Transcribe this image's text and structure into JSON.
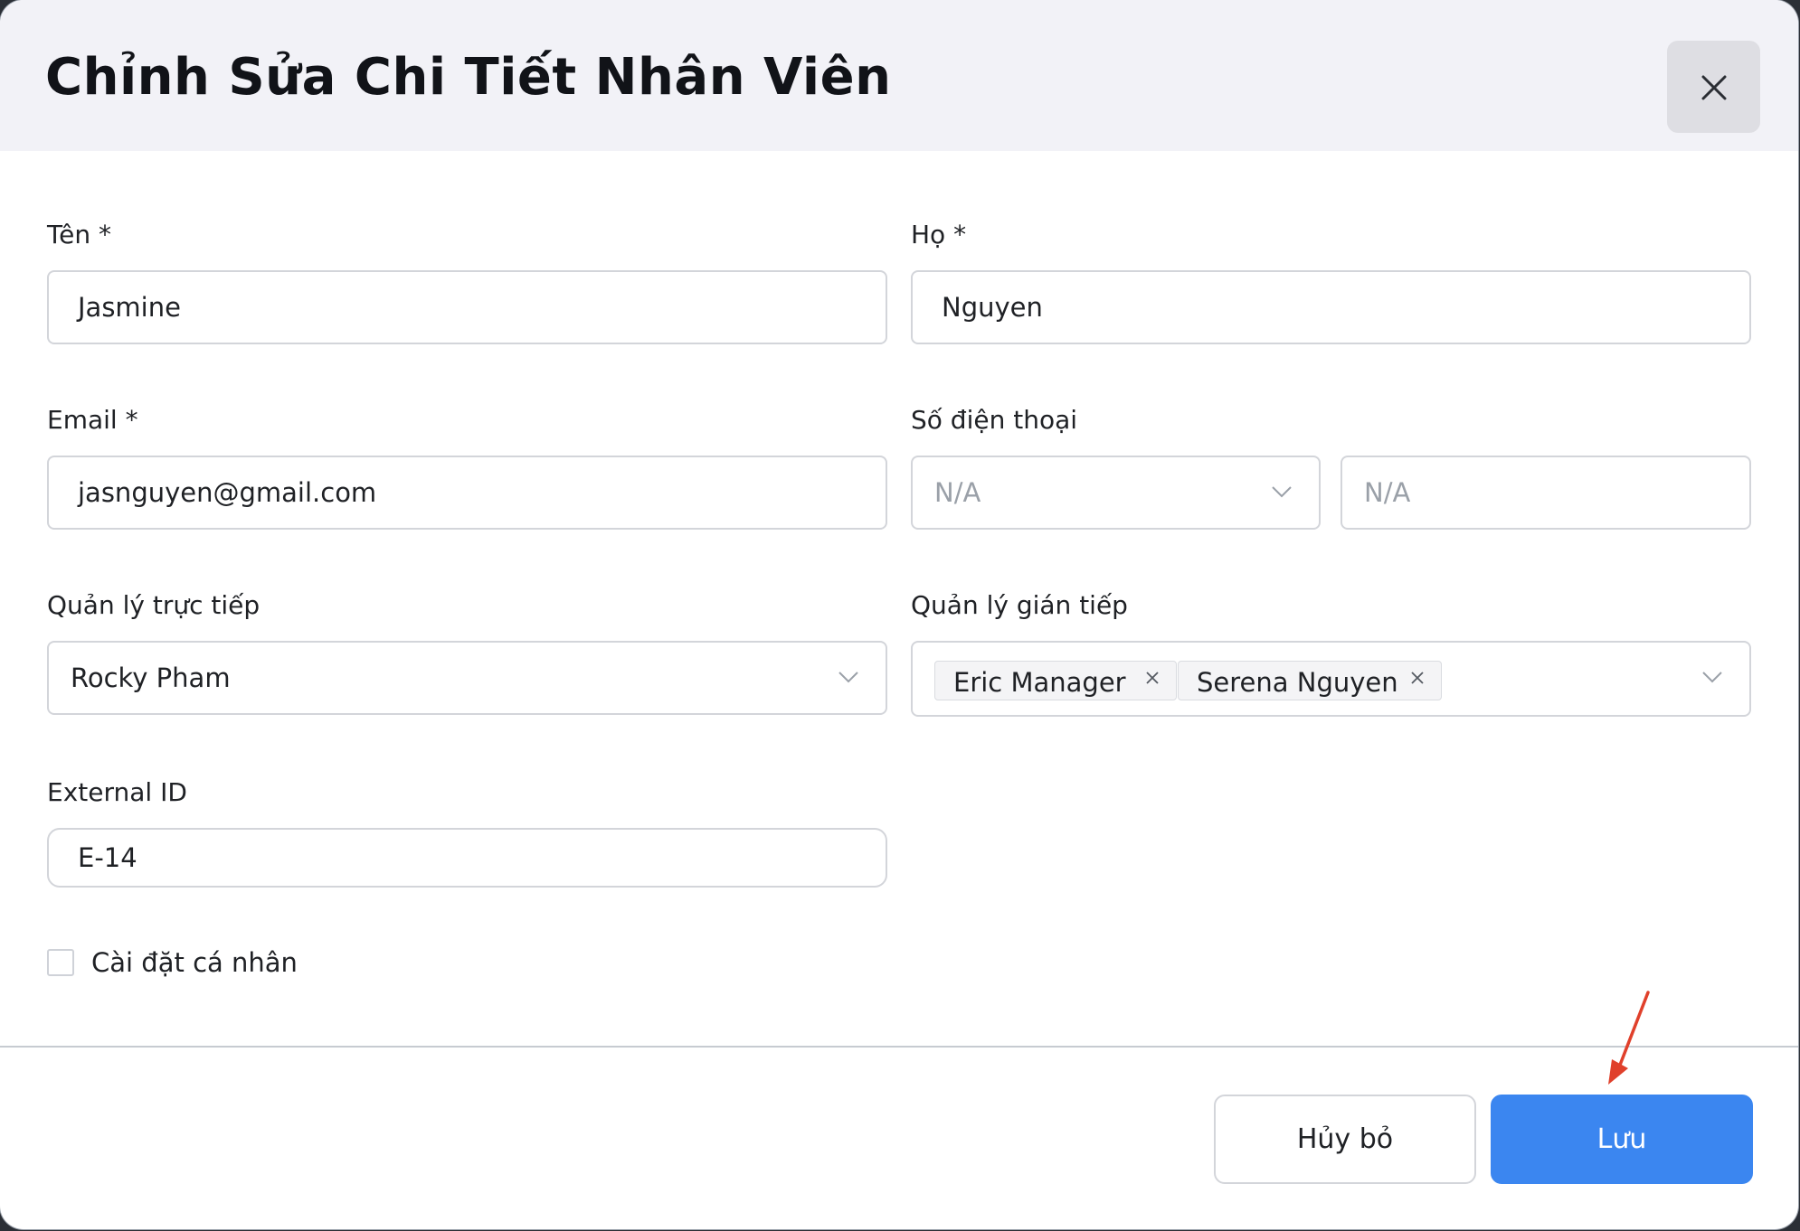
{
  "modal": {
    "title": "Chỉnh Sửa Chi Tiết Nhân Viên",
    "close_icon": "close-icon"
  },
  "form": {
    "first_name": {
      "label": "Tên *",
      "value": "Jasmine"
    },
    "last_name": {
      "label": "Họ *",
      "value": "Nguyen"
    },
    "email": {
      "label": "Email *",
      "value": "jasnguyen@gmail.com"
    },
    "phone": {
      "label": "Số điện thoại",
      "country_placeholder": "N/A",
      "number_placeholder": "N/A"
    },
    "direct_manager": {
      "label": "Quản lý trực tiếp",
      "value": "Rocky Pham"
    },
    "indirect_managers": {
      "label": "Quản lý gián tiếp",
      "tags": [
        "Eric Manager",
        "Serena Nguyen"
      ]
    },
    "external_id": {
      "label": "External ID",
      "value": "E-14"
    },
    "personal_settings": {
      "label": "Cài đặt cá nhân",
      "checked": false
    }
  },
  "footer": {
    "cancel_label": "Hủy bỏ",
    "save_label": "Lưu"
  },
  "colors": {
    "primary": "#3b86f0",
    "header_bg": "#f2f2f7",
    "annotation_arrow": "#e0402b"
  }
}
